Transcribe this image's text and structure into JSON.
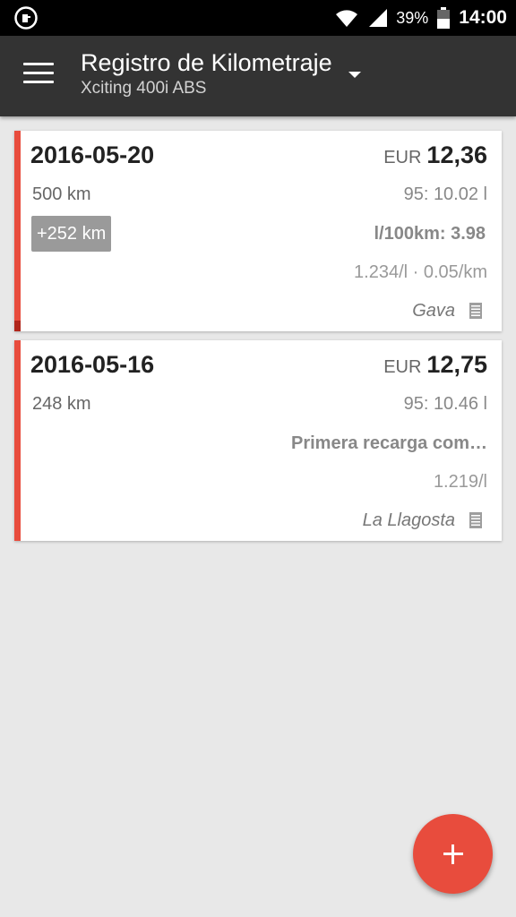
{
  "status_bar": {
    "battery_percent": "39%",
    "time": "14:00",
    "icons": [
      "fuel-app-icon",
      "wifi-icon",
      "signal-icon",
      "battery-icon"
    ]
  },
  "app_bar": {
    "title": "Registro de Kilometraje",
    "subtitle": "Xciting 400i ABS",
    "icons": [
      "menu-icon",
      "dropdown-arrow-icon"
    ]
  },
  "entries": [
    {
      "date": "2016-05-20",
      "currency": "EUR",
      "amount": "12,36",
      "odometer": "500 km",
      "fuel": "95: 10.02 l",
      "distance_badge": "+252 km",
      "consumption": "l/100km: 3.98",
      "unit_price": "1.234/l · 0.05/km",
      "station": "Gava"
    },
    {
      "date": "2016-05-16",
      "currency": "EUR",
      "amount": "12,75",
      "odometer": "248 km",
      "fuel": "95: 10.46 l",
      "note": "Primera recarga com…",
      "unit_price": "1.219/l",
      "station": "La Llagosta"
    }
  ],
  "fab": {
    "icon": "plus-icon"
  },
  "colors": {
    "accent": "#e84c3d",
    "toolbar": "#333333",
    "background": "#e8e8e8"
  }
}
